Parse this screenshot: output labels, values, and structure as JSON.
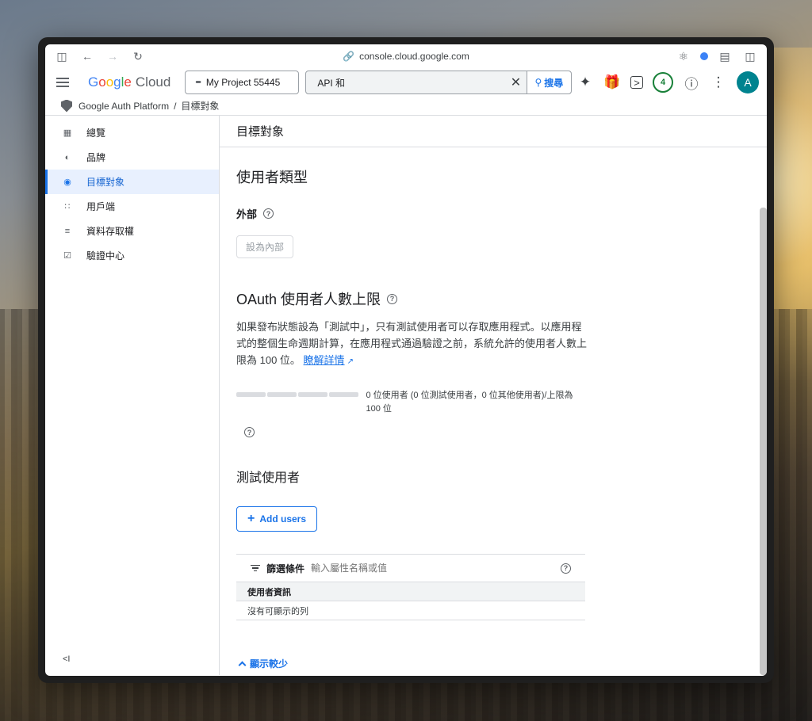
{
  "browser": {
    "url": "console.cloud.google.com"
  },
  "header": {
    "logo_google": [
      "G",
      "o",
      "o",
      "g",
      "l",
      "e"
    ],
    "logo_cloud": "Cloud",
    "project": "My Project 55445",
    "search_value": "API 和",
    "search_button": "搜尋",
    "notification_count": "4",
    "avatar_letter": "A"
  },
  "breadcrumb": {
    "product": "Google Auth Platform",
    "separator": "/",
    "current": "目標對象"
  },
  "sidebar": {
    "items": [
      {
        "label": "總覽",
        "icon": "dashboard-icon"
      },
      {
        "label": "品牌",
        "icon": "palette-icon"
      },
      {
        "label": "目標對象",
        "icon": "person-icon",
        "active": true
      },
      {
        "label": "用戶端",
        "icon": "grid-icon"
      },
      {
        "label": "資料存取權",
        "icon": "list-settings-icon"
      },
      {
        "label": "驗證中心",
        "icon": "checkbox-icon"
      }
    ],
    "collapse": "<I"
  },
  "content": {
    "title": "目標對象",
    "user_type": {
      "heading": "使用者類型",
      "value": "外部",
      "button": "設為內部"
    },
    "oauth": {
      "heading": "OAuth 使用者人數上限",
      "description": "如果發布狀態設為「測試中」，只有測試使用者可以存取應用程式。以應用程式的整個生命週期計算，在應用程式通過驗證之前，系統允許的使用者人數上限為 100 位。",
      "learn_more": "瞭解詳情",
      "usage_text": "0 位使用者 (0 位測試使用者，0 位其他使用者)/上限為 100 位",
      "usage_fraction": 0
    },
    "test_users": {
      "heading": "測試使用者",
      "add_button": "Add users",
      "filter_label": "篩選條件",
      "filter_placeholder": "輸入屬性名稱或值",
      "column_header": "使用者資訊",
      "empty_text": "沒有可顯示的列",
      "show_less": "顯示較少"
    }
  },
  "colors": {
    "accent": "#1a73e8",
    "active_bg": "#e8f0fe",
    "avatar": "#00838f",
    "badge": "#188038"
  }
}
